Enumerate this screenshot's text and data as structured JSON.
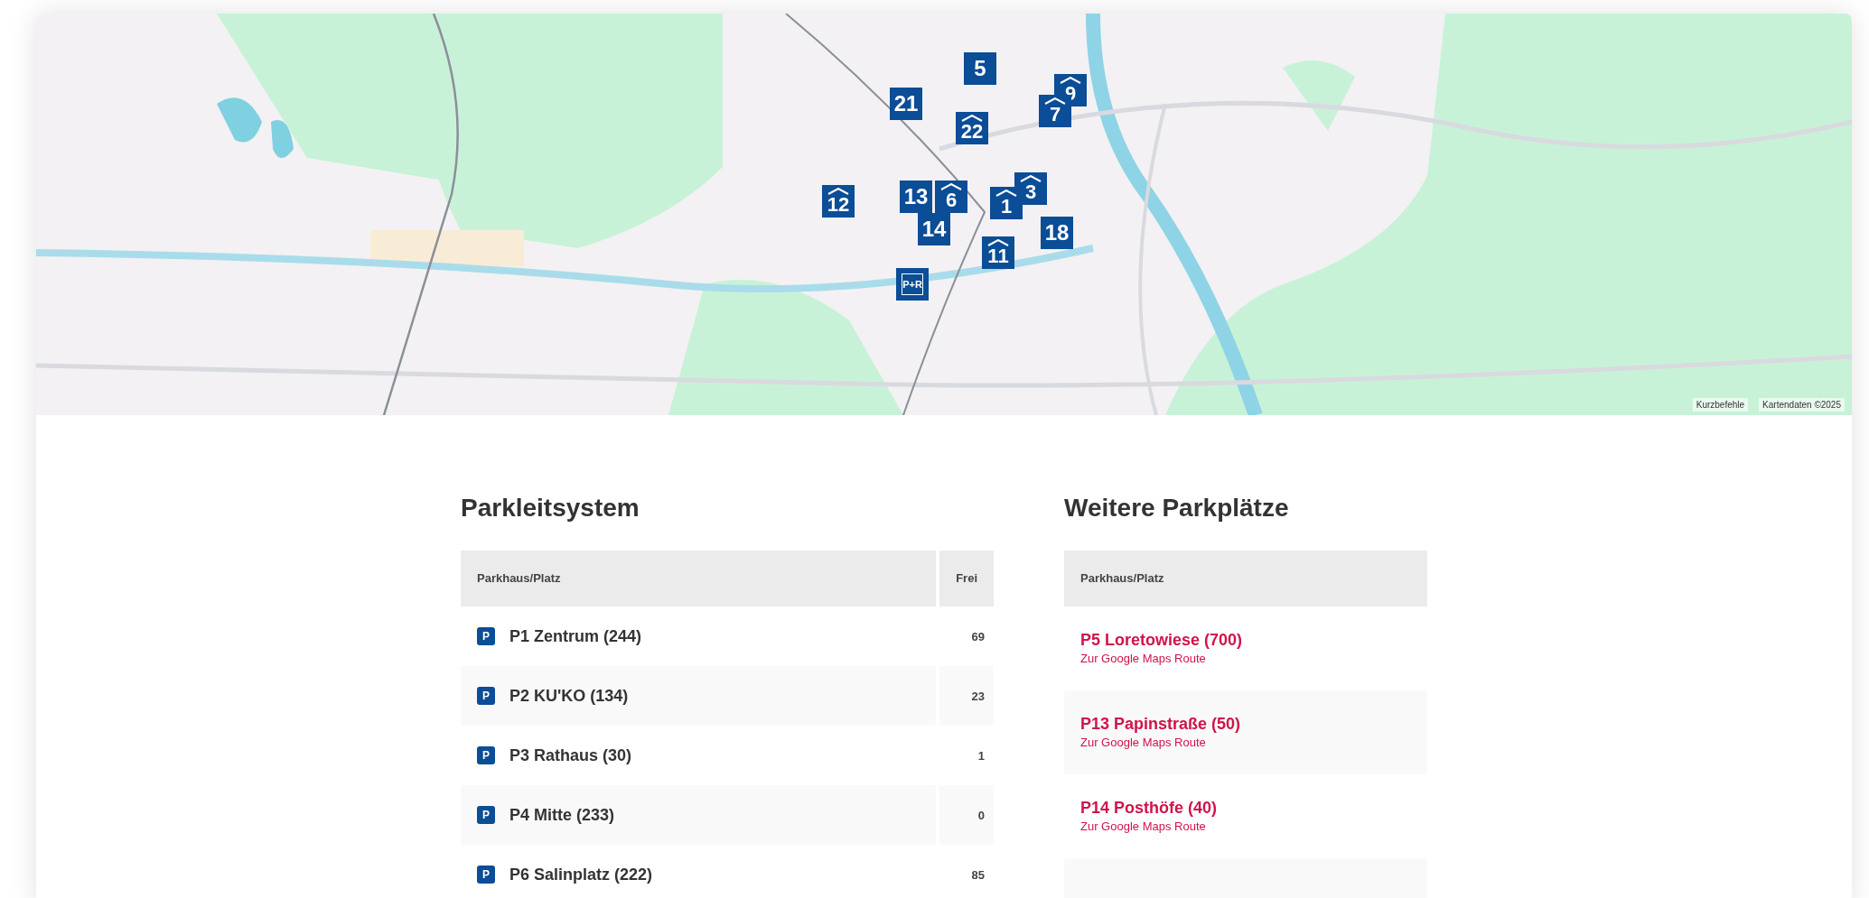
{
  "map": {
    "markers": [
      {
        "label": "5",
        "kind": "lot"
      },
      {
        "label": "21",
        "kind": "lot"
      },
      {
        "label": "22",
        "kind": "garage"
      },
      {
        "label": "9",
        "kind": "garage"
      },
      {
        "label": "7",
        "kind": "garage"
      },
      {
        "label": "12",
        "kind": "garage"
      },
      {
        "label": "13",
        "kind": "lot"
      },
      {
        "label": "6",
        "kind": "garage"
      },
      {
        "label": "3",
        "kind": "garage"
      },
      {
        "label": "1",
        "kind": "garage"
      },
      {
        "label": "14",
        "kind": "lot"
      },
      {
        "label": "18",
        "kind": "lot"
      },
      {
        "label": "11",
        "kind": "garage"
      },
      {
        "label": "P+R",
        "kind": "park-ride"
      }
    ],
    "attribution": [
      "Kurzbefehle",
      "Kartendaten ©2025"
    ]
  },
  "parkleitsystem": {
    "title": "Parkleitsystem",
    "columns": [
      "Parkhaus/Platz",
      "Frei"
    ],
    "rows": [
      {
        "icon": "P",
        "name": "P1 Zentrum (244)",
        "free": "69"
      },
      {
        "icon": "P",
        "name": "P2 KU'KO (134)",
        "free": "23"
      },
      {
        "icon": "P",
        "name": "P3 Rathaus (30)",
        "free": "1"
      },
      {
        "icon": "P",
        "name": "P4 Mitte (233)",
        "free": "0"
      },
      {
        "icon": "P",
        "name": "P6 Salinplatz (222)",
        "free": "85"
      }
    ]
  },
  "weitere": {
    "title": "Weitere Parkplätze",
    "columns": [
      "Parkhaus/Platz"
    ],
    "rows": [
      {
        "name": "P5 Loretowiese (700)",
        "link": "Zur Google Maps Route"
      },
      {
        "name": "P13 Papinstraße (50)",
        "link": "Zur Google Maps Route"
      },
      {
        "name": "P14 Posthöfe (40)",
        "link": "Zur Google Maps Route"
      }
    ]
  }
}
